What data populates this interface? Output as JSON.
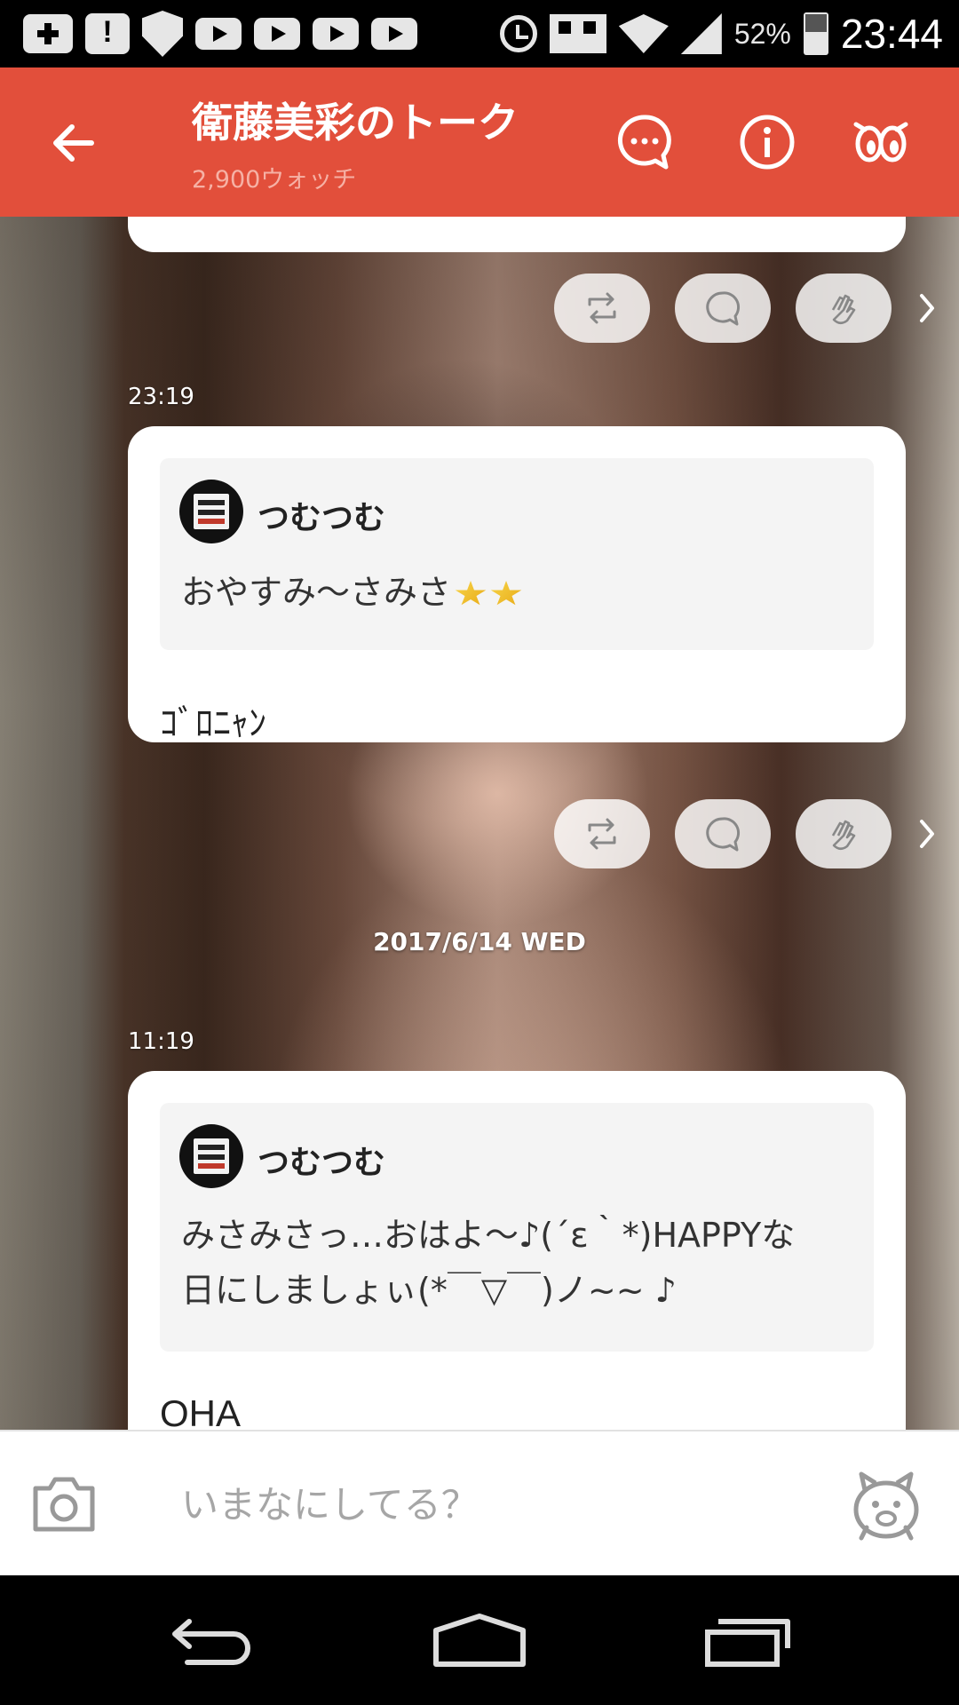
{
  "status_bar": {
    "battery": "52%",
    "time": "23:44"
  },
  "header": {
    "title": "衛藤美彩のトーク",
    "subtitle": "2,900ウォッチ"
  },
  "messages": [
    {
      "time": "23:19",
      "quote_author": "つむつむ",
      "quote_text": "おやすみ〜さみさ",
      "comment": "ｺﾞﾛﾆｬﾝ"
    },
    {
      "time": "11:19",
      "quote_author": "つむつむ",
      "quote_text_line1": "みさみさっ…おはよ〜♪(´ε｀*)HAPPYな",
      "quote_text_line2": "日にしましょぃ(*￣▽￣)ノ~~ ♪",
      "comment": "OHA"
    }
  ],
  "date_separator": "2017/6/14 WED",
  "input": {
    "placeholder": "いまなにしてる？"
  },
  "icons": {
    "back": "arrow-left-icon",
    "comments": "speech-bubble-dots-icon",
    "info": "info-icon",
    "watch": "eyes-icon",
    "retalk": "repost-icon",
    "comment": "speech-bubble-icon",
    "cheer": "clap-icon",
    "camera": "camera-icon",
    "sticker": "bear-sticker-icon"
  },
  "colors": {
    "accent": "#e24f3b",
    "subtitle": "#f6b1a5"
  }
}
